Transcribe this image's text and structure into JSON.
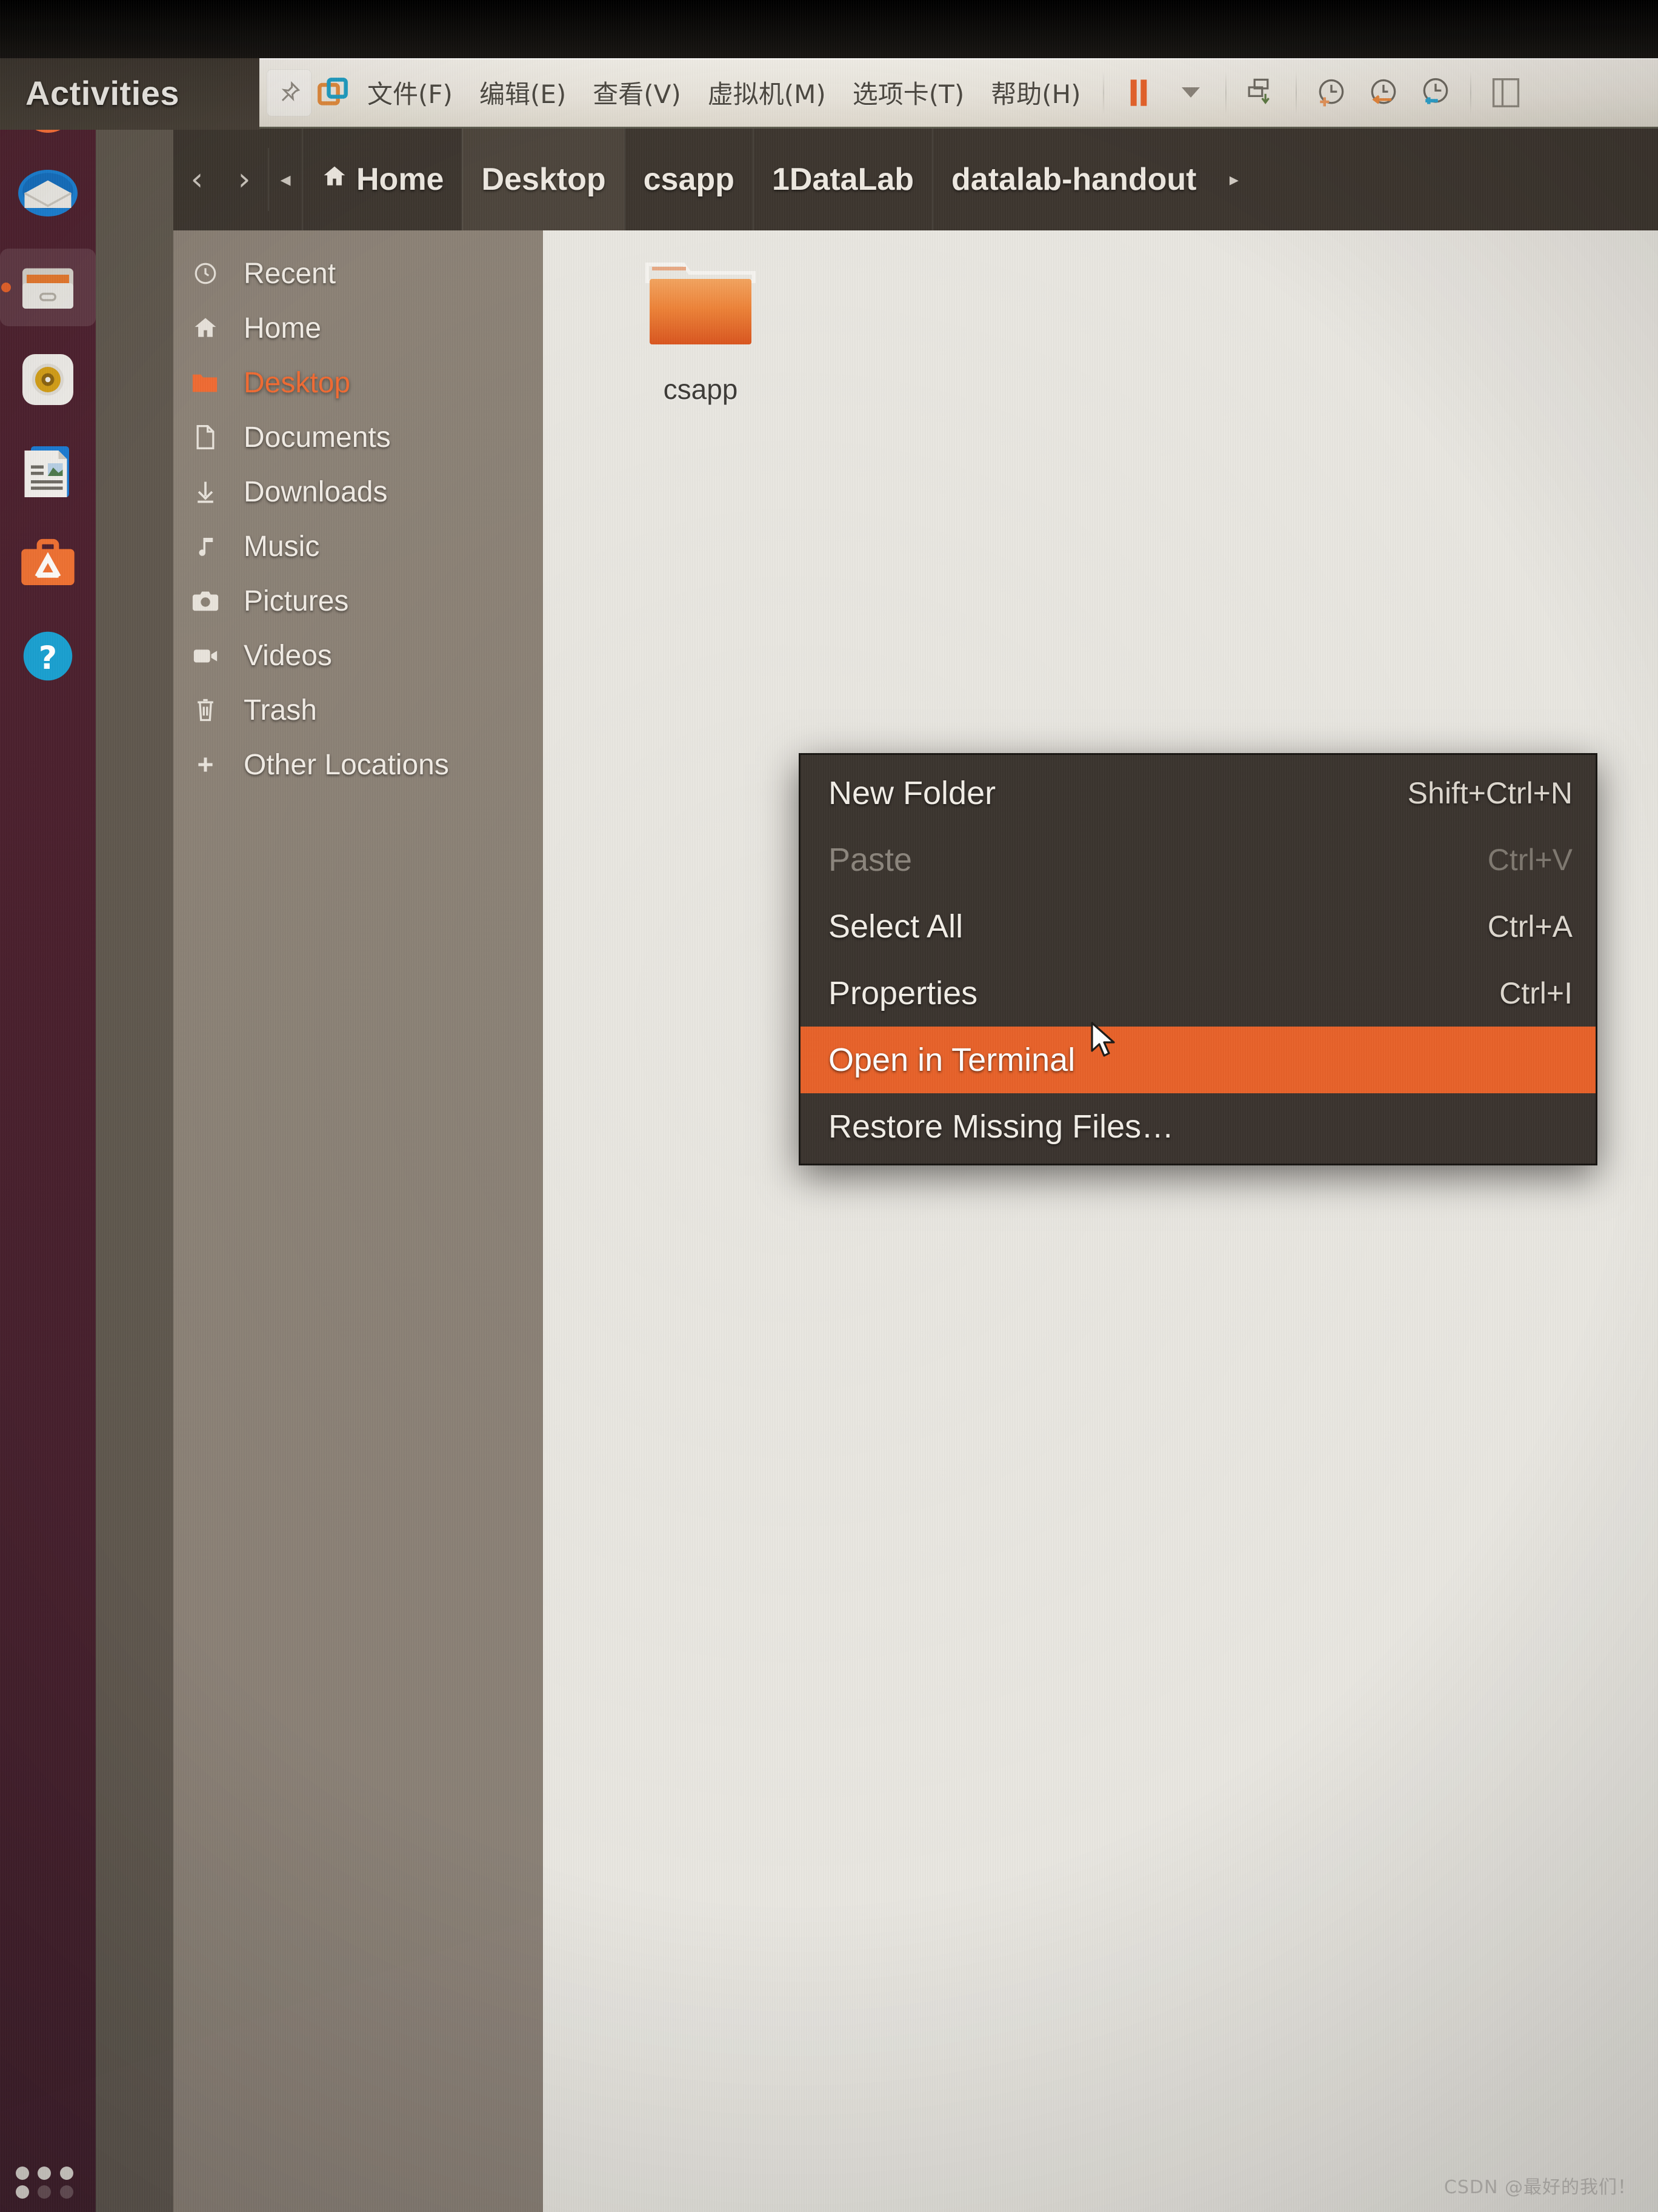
{
  "colors": {
    "accent_orange": "#e8622a",
    "selected_text_orange": "#f06a33",
    "menu_bg": "#3a342f",
    "sidebar_bg": "#8a8176",
    "dock_bg": "#481f2d",
    "files_bg": "#e9e7e1",
    "headerbar_bg": "#3b352f"
  },
  "gnome": {
    "activities_label": "Activities"
  },
  "vmware": {
    "pin_icon": "pin-icon",
    "logo_icon": "vmware-logo-icon",
    "menu": [
      {
        "label": "文件(F)"
      },
      {
        "label": "编辑(E)"
      },
      {
        "label": "查看(V)"
      },
      {
        "label": "虚拟机(M)"
      },
      {
        "label": "选项卡(T)"
      },
      {
        "label": "帮助(H)"
      }
    ],
    "toolbar": [
      {
        "name": "suspend-button",
        "icon": "pause-icon"
      },
      {
        "name": "power-dropdown",
        "icon": "chevron-down-icon"
      },
      {
        "name": "send-ctrl-alt-del-button",
        "icon": "send-to-icon"
      },
      {
        "name": "take-snapshot-button",
        "icon": "snapshot-add-icon"
      },
      {
        "name": "revert-snapshot-button",
        "icon": "snapshot-revert-icon"
      },
      {
        "name": "snapshot-manager-button",
        "icon": "snapshot-manager-icon"
      },
      {
        "name": "toggle-sidebar-button",
        "icon": "sidebar-toggle-icon"
      }
    ]
  },
  "dock": {
    "items": [
      {
        "name": "dock-item-firefox",
        "icon": "firefox-icon",
        "active": false
      },
      {
        "name": "dock-item-thunderbird",
        "icon": "thunderbird-mail-icon",
        "active": false
      },
      {
        "name": "dock-item-files",
        "icon": "files-nautilus-icon",
        "active": true
      },
      {
        "name": "dock-item-rhythmbox",
        "icon": "rhythmbox-icon",
        "active": false
      },
      {
        "name": "dock-item-libreoffice-writer",
        "icon": "libreoffice-writer-icon",
        "active": false
      },
      {
        "name": "dock-item-ubuntu-software",
        "icon": "ubuntu-software-icon",
        "active": false
      },
      {
        "name": "dock-item-help",
        "icon": "help-question-icon",
        "active": false
      }
    ],
    "show_applications": "show-applications-grid-icon"
  },
  "nautilus": {
    "nav": {
      "back_icon": "chevron-left-icon",
      "forward_icon": "chevron-right-icon",
      "overflow_icon": "chevron-left-small-icon",
      "end_icon": "chevron-right-small-icon"
    },
    "breadcrumbs": [
      {
        "label": "Home",
        "icon": "home-icon",
        "active": false
      },
      {
        "label": "Desktop",
        "icon": "",
        "active": true
      },
      {
        "label": "csapp",
        "icon": "",
        "active": false
      },
      {
        "label": "1DataLab",
        "icon": "",
        "active": false
      },
      {
        "label": "datalab-handout",
        "icon": "",
        "active": false
      }
    ],
    "places": [
      {
        "label": "Recent",
        "icon": "clock-icon",
        "selected": false
      },
      {
        "label": "Home",
        "icon": "home-icon",
        "selected": false
      },
      {
        "label": "Desktop",
        "icon": "folder-icon",
        "selected": true
      },
      {
        "label": "Documents",
        "icon": "document-icon",
        "selected": false
      },
      {
        "label": "Downloads",
        "icon": "download-arrow-icon",
        "selected": false
      },
      {
        "label": "Music",
        "icon": "music-note-icon",
        "selected": false
      },
      {
        "label": "Pictures",
        "icon": "camera-icon",
        "selected": false
      },
      {
        "label": "Videos",
        "icon": "video-camera-icon",
        "selected": false
      },
      {
        "label": "Trash",
        "icon": "trash-icon",
        "selected": false
      },
      {
        "label": "Other Locations",
        "icon": "plus-icon",
        "selected": false
      }
    ],
    "files": [
      {
        "name": "csapp",
        "icon": "folder-icon"
      }
    ]
  },
  "context_menu": {
    "items": [
      {
        "label": "New Folder",
        "accel": "Shift+Ctrl+N",
        "state": "normal"
      },
      {
        "label": "Paste",
        "accel": "Ctrl+V",
        "state": "disabled"
      },
      {
        "label": "Select All",
        "accel": "Ctrl+A",
        "state": "normal"
      },
      {
        "label": "Properties",
        "accel": "Ctrl+I",
        "state": "normal"
      },
      {
        "label": "Open in Terminal",
        "accel": "",
        "state": "highlighted"
      },
      {
        "label": "Restore Missing Files…",
        "accel": "",
        "state": "normal"
      }
    ]
  },
  "watermark": {
    "text": "CSDN @最好的我们！"
  }
}
